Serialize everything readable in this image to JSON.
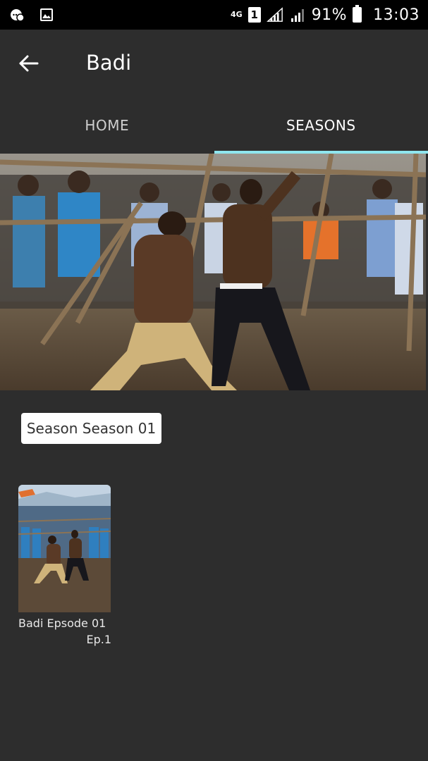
{
  "status_bar": {
    "network": "4G",
    "sim": "1",
    "battery_percent": "91%",
    "time": "13:03",
    "icons": [
      "message-dots-icon",
      "image-icon",
      "signal-icon",
      "battery-icon"
    ]
  },
  "app_bar": {
    "title": "Badi",
    "back_icon": "arrow-left-icon"
  },
  "tabs": [
    {
      "label": "HOME",
      "active": false
    },
    {
      "label": "SEASONS",
      "active": true
    }
  ],
  "colors": {
    "background": "#2d2d2d",
    "tab_indicator": "#8fe6ee",
    "status_bar": "#000000"
  },
  "season": {
    "selected": "Season Season 01"
  },
  "episodes": [
    {
      "title": "Badi Epsode 01",
      "number": "Ep.1"
    }
  ]
}
